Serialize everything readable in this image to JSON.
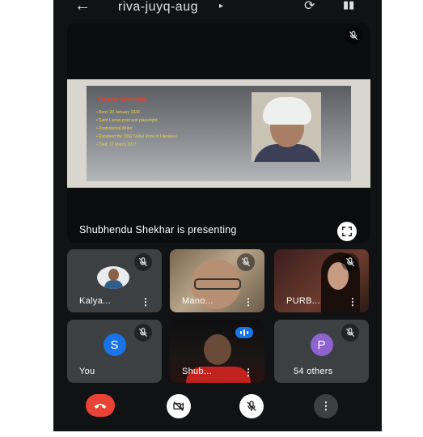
{
  "top_bar": {
    "meeting_code": "riva-juyq-aug",
    "back_icon": "arrow-left-icon",
    "switch_camera_icon": "switch-camera-icon",
    "speaker_icon": "speaker-icon"
  },
  "presentation": {
    "caption": "Shubhendu Shekhar is presenting",
    "slide": {
      "title": "Derek Walcott",
      "bullets": [
        "Born: 23 January 1930",
        "Saint Lucian poet and playwright",
        "Postcolonial Writer",
        "Received the 1992 Nobel Prize in Literature",
        "Died: 17 March 2017"
      ]
    }
  },
  "participants": [
    {
      "name": "Kalya...",
      "type": "photo-avatar",
      "muted": true
    },
    {
      "name": "Mano...",
      "type": "video",
      "muted": true
    },
    {
      "name": "PURB...",
      "type": "video",
      "muted": true
    },
    {
      "name": "You",
      "type": "initial",
      "initial": "S",
      "avatar_color": "#1a73e8",
      "muted": true
    },
    {
      "name": "Shub...",
      "type": "video",
      "muted": false,
      "speaking": true
    },
    {
      "name": "54 others",
      "type": "initial",
      "initial": "P",
      "avatar_color": "#8e63ce",
      "muted": true
    }
  ],
  "controls": {
    "end_call_icon": "end-call-icon",
    "camera_icon": "camera-off-icon",
    "mic_icon": "mic-off-icon",
    "more_icon": "more-vert-icon"
  },
  "colors": {
    "background": "#111214",
    "tile": "#3c4043",
    "end_call": "#ea4335",
    "accent": "#1a73e8"
  }
}
